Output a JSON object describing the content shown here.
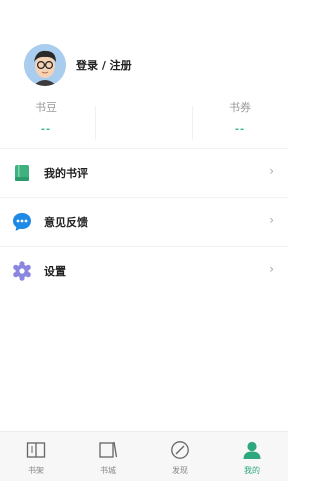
{
  "profile": {
    "login_text": "登录 / 注册"
  },
  "stats": [
    {
      "label": "书豆",
      "value": "--"
    },
    {
      "label": "书券",
      "value": "--"
    }
  ],
  "menu": [
    {
      "label": "我的书评",
      "icon": "book-icon",
      "color": "#3db27f"
    },
    {
      "label": "意见反馈",
      "icon": "chat-bubble-icon",
      "color": "#1e8ae6"
    },
    {
      "label": "设置",
      "icon": "gear-icon",
      "color": "#8b87e0"
    }
  ],
  "tabs": [
    {
      "label": "书架",
      "icon": "bookshelf-icon",
      "active": false
    },
    {
      "label": "书城",
      "icon": "bookstore-icon",
      "active": false
    },
    {
      "label": "发现",
      "icon": "compass-icon",
      "active": false
    },
    {
      "label": "我的",
      "icon": "user-icon",
      "active": true
    }
  ],
  "colors": {
    "accent": "#2ea77c",
    "stat_value": "#39b98a"
  }
}
